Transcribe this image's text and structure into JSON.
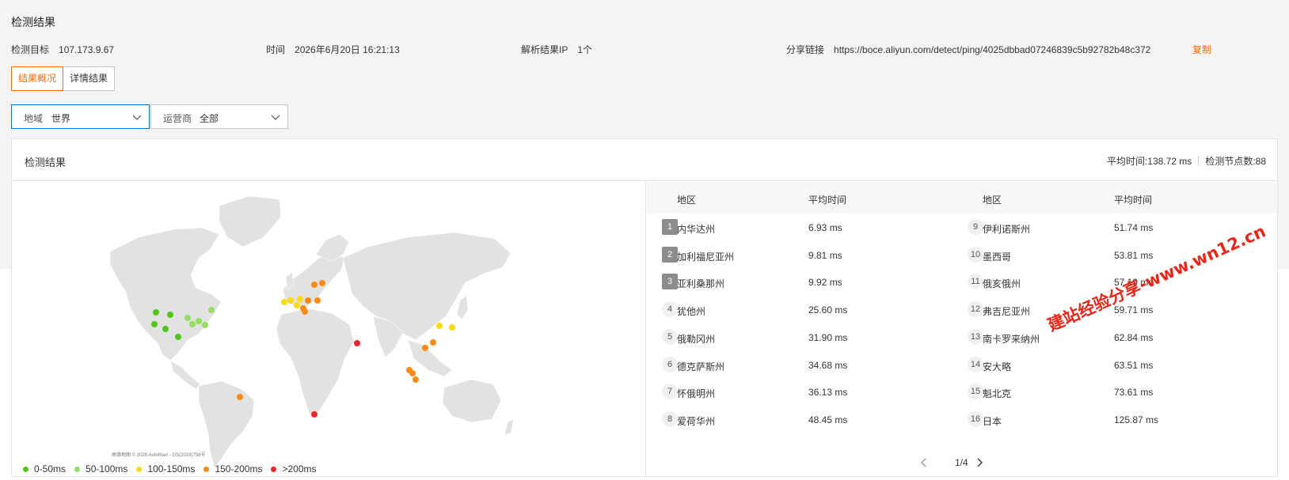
{
  "page_title": "检测结果",
  "info": {
    "target_label": "检测目标",
    "target_value": "107.173.9.67",
    "time_label": "时间",
    "time_value": "2026年6月20日 16:21:13",
    "ip_label": "解析结果IP",
    "ip_count": "1个",
    "share_label": "分享链接",
    "share_url": "https://boce.aliyun.com/detect/ping/4025dbbad07246839c5b92782b48c372",
    "copy_label": "复制"
  },
  "tabs": [
    {
      "label": "结果概况",
      "active": true
    },
    {
      "label": "详情结果",
      "active": false
    }
  ],
  "filters": {
    "region_label": "地域",
    "region_value": "世界",
    "isp_label": "运营商",
    "isp_value": "全部"
  },
  "card": {
    "title": "检测结果",
    "avg_time": "平均时间:138.72 ms",
    "node_count": "检测节点数:88"
  },
  "table": {
    "col_region": "地区",
    "col_avg": "平均时间",
    "rows": [
      {
        "rank": "1",
        "region": "内华达州",
        "time": "6.93 ms"
      },
      {
        "rank": "2",
        "region": "加利福尼亚州",
        "time": "9.81 ms"
      },
      {
        "rank": "3",
        "region": "亚利桑那州",
        "time": "9.92 ms"
      },
      {
        "rank": "4",
        "region": "犹他州",
        "time": "25.60 ms"
      },
      {
        "rank": "5",
        "region": "俄勒冈州",
        "time": "31.90 ms"
      },
      {
        "rank": "6",
        "region": "德克萨斯州",
        "time": "34.68 ms"
      },
      {
        "rank": "7",
        "region": "怀俄明州",
        "time": "36.13 ms"
      },
      {
        "rank": "8",
        "region": "爱荷华州",
        "time": "48.45 ms"
      },
      {
        "rank": "9",
        "region": "伊利诺斯州",
        "time": "51.74 ms"
      },
      {
        "rank": "10",
        "region": "墨西哥",
        "time": "53.81 ms"
      },
      {
        "rank": "11",
        "region": "俄亥俄州",
        "time": "57.19 ms"
      },
      {
        "rank": "12",
        "region": "弗吉尼亚州",
        "time": "59.71 ms"
      },
      {
        "rank": "13",
        "region": "南卡罗来纳州",
        "time": "62.84 ms"
      },
      {
        "rank": "14",
        "region": "安大略",
        "time": "63.51 ms"
      },
      {
        "rank": "15",
        "region": "魁北克",
        "time": "73.61 ms"
      },
      {
        "rank": "16",
        "region": "日本",
        "time": "125.87 ms"
      }
    ]
  },
  "pager": {
    "text": "1/4"
  },
  "legend": [
    {
      "label": "0-50ms",
      "color": "#52c41a"
    },
    {
      "label": "50-100ms",
      "color": "#95de64"
    },
    {
      "label": "100-150ms",
      "color": "#fadb14"
    },
    {
      "label": "150-200ms",
      "color": "#fa8c16"
    },
    {
      "label": ">200ms",
      "color": "#f5222d"
    }
  ],
  "map": {
    "attribution": "高德地图 © 2026 AutoNavi - GS(2019)758号"
  },
  "watermark": "建站经验分享-www.wn12.cn",
  "colors": {
    "accent": "#ff6a00",
    "focus_border": "#0070cc"
  },
  "icons": {
    "select_arrow": "chevron-down-icon",
    "prev_page": "chevron-left-icon",
    "next_page": "chevron-right-icon"
  }
}
